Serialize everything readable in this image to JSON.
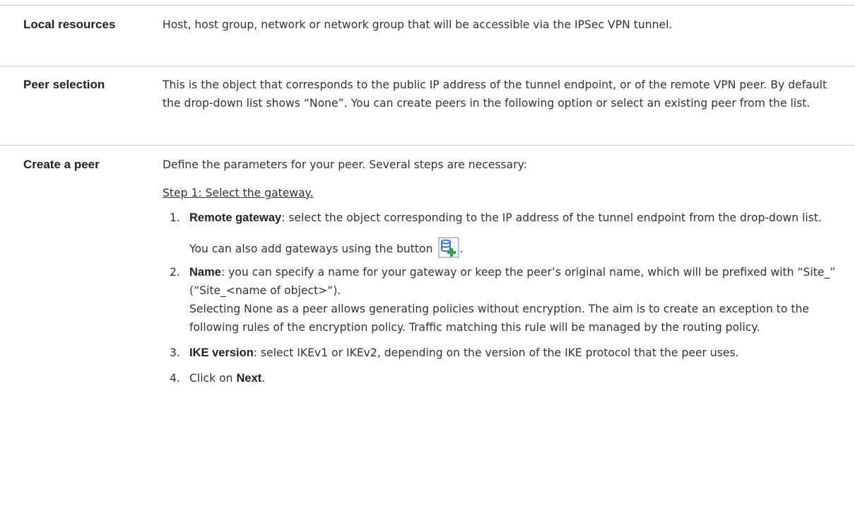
{
  "rows": [
    {
      "term": "Local resources",
      "definition": "Host, host group, network or network group that will be accessible via the IPSec VPN tunnel."
    },
    {
      "term": "Peer selection",
      "definition": "This is the object that corresponds to the public IP address of the tunnel endpoint, or of the remote VPN peer. By default the drop-down list shows “None”. You can create peers in the following option or select an existing peer from the list."
    },
    {
      "term": "Create a peer",
      "intro": "Define the parameters for your peer. Several steps are necessary:",
      "step_title": "Step 1: Select the gateway.",
      "items": [
        {
          "num": "1.",
          "label": "Remote gateway",
          "text": ": select the object corresponding to the IP address of the tunnel endpoint from the drop-down list.",
          "note": "You can also add gateways using the button",
          "note_end": "."
        },
        {
          "num": "2.",
          "label": "Name",
          "text": ": you can specify a name for your gateway or keep the peer’s original name, which will be prefixed with “Site_” (“Site_<name of object>“).",
          "note": "Selecting None as a peer allows generating policies without encryption. The aim is to create an exception to the following rules of the encryption policy. Traffic matching this rule will be managed by the routing policy."
        },
        {
          "num": "3.",
          "label": "IKE version",
          "text": ": select IKEv1 or IKEv2, depending on the version of the IKE protocol that the peer uses."
        },
        {
          "num": "4.",
          "pre": "Click on ",
          "label": "Next",
          "text": "."
        }
      ]
    }
  ],
  "icons": {
    "add_gateway": "add-gateway-icon"
  },
  "colors": {
    "rule": "#c9c9c9",
    "icon_blue": "#3a78c2",
    "icon_plus": "#35a04a"
  }
}
